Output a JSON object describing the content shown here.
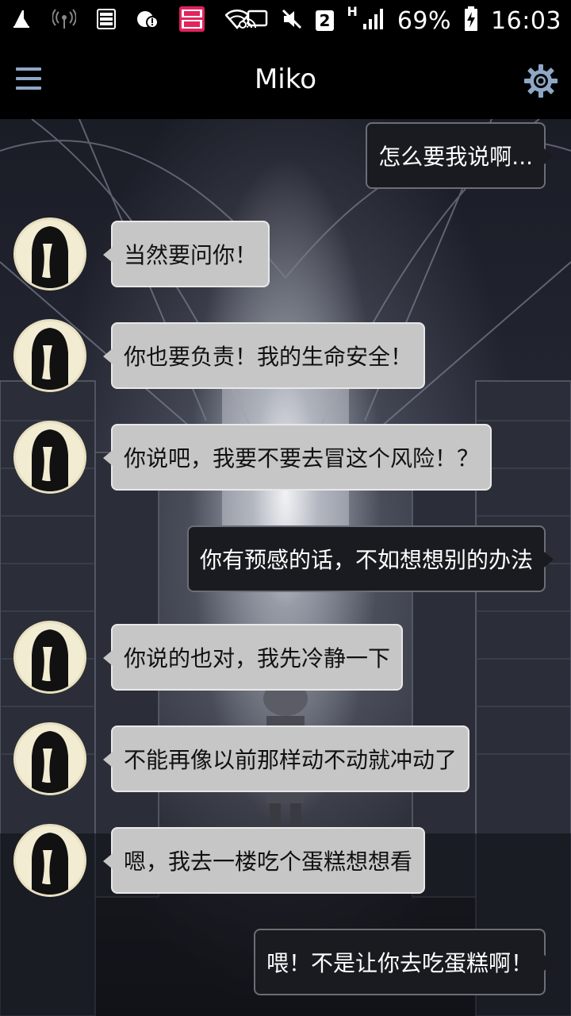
{
  "status_bar": {
    "sim_slot": "2",
    "network_type": "H",
    "battery_percent": "69%",
    "time": "16:03",
    "icons": [
      "cleaner-icon",
      "wifi-hotspot-icon",
      "storage-icon",
      "alert-icon",
      "app-badge-icon",
      "wifi-icon",
      "cast-icon",
      "mute-icon",
      "sim-icon",
      "signal-icon",
      "battery-charging-icon"
    ]
  },
  "header": {
    "title": "Miko",
    "menu_icon": "hamburger-menu-icon",
    "settings_icon": "gear-icon",
    "accent": "#8ea7c6"
  },
  "messages": [
    {
      "side": "right",
      "text": "怎么要我说啊..."
    },
    {
      "side": "left",
      "text": "当然要问你！"
    },
    {
      "side": "left",
      "text": "你也要负责！我的生命安全！"
    },
    {
      "side": "left",
      "text": "你说吧，我要不要去冒这个风险！？"
    },
    {
      "side": "right",
      "text": "你有预感的话，不如想想别的办法"
    },
    {
      "side": "left",
      "text": "你说的也对，我先冷静一下"
    },
    {
      "side": "left",
      "text": "不能再像以前那样动不动就冲动了"
    },
    {
      "side": "left",
      "text": "嗯，我去一楼吃个蛋糕想想看"
    },
    {
      "side": "right",
      "text": "喂！不是让你去吃蛋糕啊！"
    }
  ],
  "colors": {
    "left_bubble": "#c6c6c6",
    "right_bubble": "#1a1b20",
    "avatar_bg": "#f2ecd2"
  }
}
